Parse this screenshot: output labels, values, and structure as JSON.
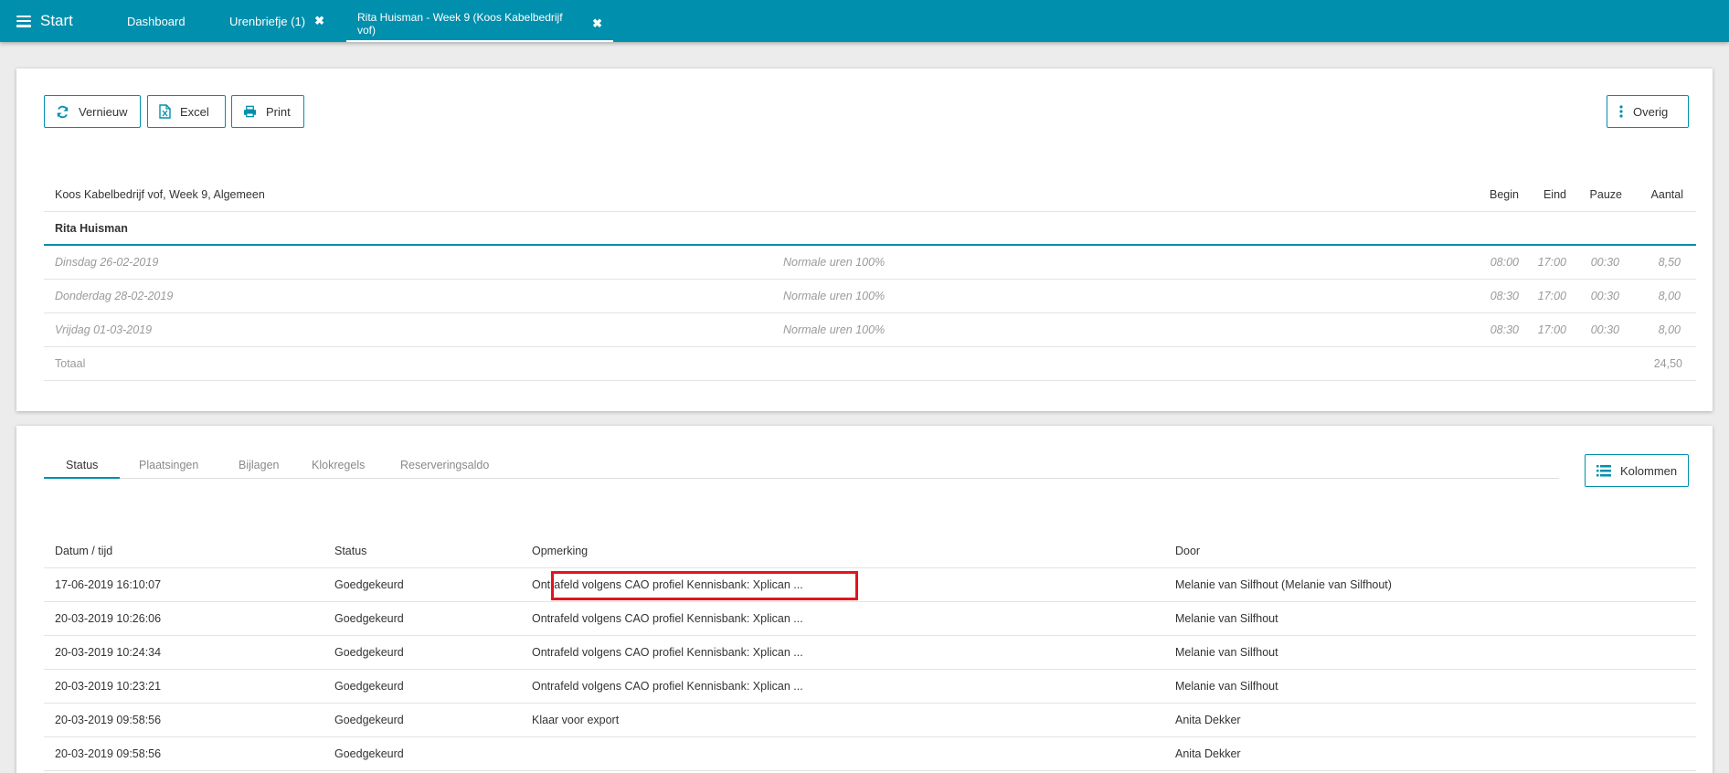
{
  "topbar": {
    "start_label": "Start",
    "tabs": [
      {
        "label": "Dashboard"
      },
      {
        "label": "Urenbriefje (1)",
        "close": "✖"
      },
      {
        "label": "Rita Huisman - Week 9 (Koos Kabelbedrijf vof)",
        "close": "✖"
      }
    ]
  },
  "toolbar": {
    "refresh_label": "Vernieuw",
    "excel_label": "Excel",
    "print_label": "Print",
    "more_label": "Overig"
  },
  "timesheet": {
    "title": "Koos Kabelbedrijf vof, Week 9, Algemeen",
    "columns": {
      "begin": "Begin",
      "eind": "Eind",
      "pauze": "Pauze",
      "aantal": "Aantal"
    },
    "employee": "Rita Huisman",
    "entries": [
      {
        "date": "Dinsdag 26-02-2019",
        "type": "Normale uren 100%",
        "begin": "08:00",
        "eind": "17:00",
        "pauze": "00:30",
        "aantal": "8,50"
      },
      {
        "date": "Donderdag 28-02-2019",
        "type": "Normale uren 100%",
        "begin": "08:30",
        "eind": "17:00",
        "pauze": "00:30",
        "aantal": "8,00"
      },
      {
        "date": "Vrijdag 01-03-2019",
        "type": "Normale uren 100%",
        "begin": "08:30",
        "eind": "17:00",
        "pauze": "00:30",
        "aantal": "8,00"
      }
    ],
    "total_label": "Totaal",
    "total_value": "24,50"
  },
  "detail_tabs": [
    "Status",
    "Plaatsingen",
    "Bijlagen",
    "Klokregels",
    "Reserveringsaldo"
  ],
  "columns_button_label": "Kolommen",
  "status_table": {
    "headers": {
      "datetime": "Datum / tijd",
      "status": "Status",
      "remark": "Opmerking",
      "by": "Door"
    },
    "rows": [
      {
        "datetime": "17-06-2019 16:10:07",
        "status": "Goedgekeurd",
        "remark": "Ontrafeld volgens CAO profiel Kennisbank: Xplican ...",
        "by": "Melanie van Silfhout (Melanie van Silfhout)"
      },
      {
        "datetime": "20-03-2019 10:26:06",
        "status": "Goedgekeurd",
        "remark": "Ontrafeld volgens CAO profiel Kennisbank: Xplican ...",
        "by": "Melanie van Silfhout"
      },
      {
        "datetime": "20-03-2019 10:24:34",
        "status": "Goedgekeurd",
        "remark": "Ontrafeld volgens CAO profiel Kennisbank: Xplican ...",
        "by": "Melanie van Silfhout"
      },
      {
        "datetime": "20-03-2019 10:23:21",
        "status": "Goedgekeurd",
        "remark": "Ontrafeld volgens CAO profiel Kennisbank: Xplican ...",
        "by": "Melanie van Silfhout"
      },
      {
        "datetime": "20-03-2019 09:58:56",
        "status": "Goedgekeurd",
        "remark": "Klaar voor export",
        "by": "Anita Dekker"
      },
      {
        "datetime": "20-03-2019 09:58:56",
        "status": "Goedgekeurd",
        "remark": "",
        "by": "Anita Dekker"
      }
    ]
  }
}
